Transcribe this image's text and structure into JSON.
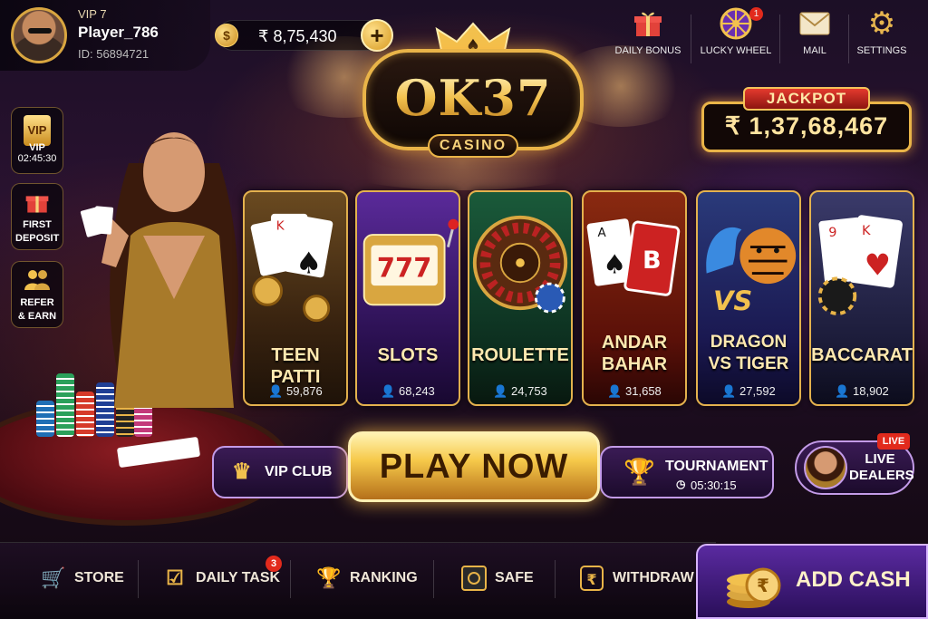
{
  "player": {
    "vip": "VIP 7",
    "name": "Player_786",
    "id": "ID: 56894721"
  },
  "balance": {
    "currency_symbol": "$",
    "amount": "₹ 8,75,430",
    "add_label": "+"
  },
  "logo": {
    "title": "OK37",
    "subtitle": "CASINO"
  },
  "top_nav": [
    {
      "label": "DAILY BONUS",
      "icon": "gift-icon"
    },
    {
      "label": "LUCKY WHEEL",
      "icon": "wheel-icon",
      "badge": "1"
    },
    {
      "label": "MAIL",
      "icon": "mail-icon"
    },
    {
      "label": "SETTINGS",
      "icon": "gear-icon"
    }
  ],
  "jackpot": {
    "label": "JACKPOT",
    "value": "₹ 1,37,68,467"
  },
  "side_buttons": [
    {
      "label": "VIP",
      "sub": "02:45:30",
      "icon_text": "VIP"
    },
    {
      "label": "FIRST DEPOSIT",
      "icon": "gift-icon"
    },
    {
      "label": "REFER & EARN",
      "icon": "users-icon"
    }
  ],
  "games": [
    {
      "name": "TEEN PATTI",
      "players": "59,876"
    },
    {
      "name": "SLOTS",
      "players": "68,243"
    },
    {
      "name": "ROULETTE",
      "players": "24,753"
    },
    {
      "name": "ANDAR BAHAR",
      "players": "31,658"
    },
    {
      "name": "DRAGON VS TIGER",
      "players": "27,592"
    },
    {
      "name": "BACCARAT",
      "players": "18,902"
    }
  ],
  "actions": {
    "vip_club": "VIP CLUB",
    "play_now": "PLAY NOW",
    "tournament": "TOURNAMENT",
    "tournament_time": "05:30:15",
    "live_dealers": "LIVE DEALERS",
    "live_badge": "LIVE"
  },
  "bottom_nav": [
    {
      "label": "STORE",
      "icon": "cart-icon"
    },
    {
      "label": "DAILY TASK",
      "icon": "task-icon",
      "badge": "3"
    },
    {
      "label": "RANKING",
      "icon": "trophy-icon"
    },
    {
      "label": "SAFE",
      "icon": "safe-icon"
    },
    {
      "label": "WITHDRAW",
      "icon": "rupee-icon"
    }
  ],
  "add_cash": "ADD CASH",
  "colors": {
    "gold": "#e9b448",
    "purple": "#5a2aa0",
    "red": "#e22a1c"
  }
}
